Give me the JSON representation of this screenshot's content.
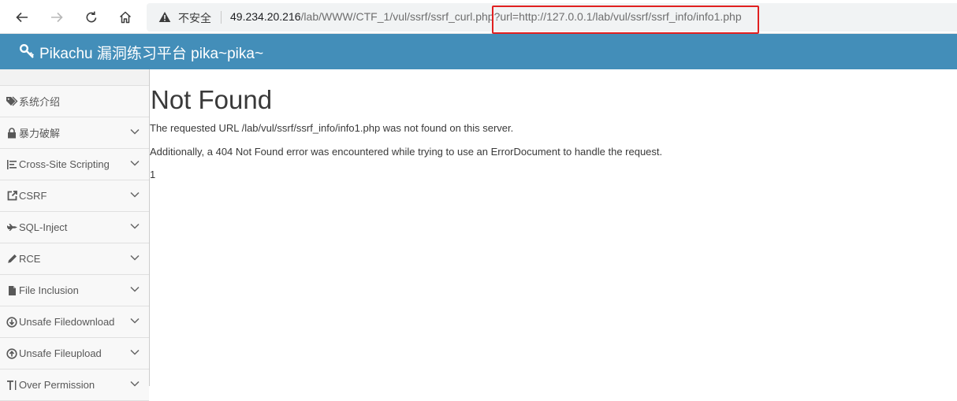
{
  "browser": {
    "not_secure_label": "不安全",
    "url_host": "49.234.20.216",
    "url_path": "/lab/WWW/CTF_1/vul/ssrf/ssrf_curl.php",
    "url_query": "?url=http://127.0.0.1/lab/vul/ssrf/ssrf_info/info1.php",
    "icons": [
      "back-arrow-icon",
      "forward-arrow-icon",
      "reload-icon",
      "home-icon",
      "warning-icon"
    ],
    "highlight_color": "#e02020"
  },
  "header": {
    "brand": "Pikachu 漏洞练习平台 pika~pika~",
    "icon": "key-icon",
    "background": "#438eb9"
  },
  "sidebar": {
    "items": [
      {
        "label": "系统介绍",
        "icon": "tags-icon",
        "has_submenu": false
      },
      {
        "label": "暴力破解",
        "icon": "lock-icon",
        "has_submenu": true
      },
      {
        "label": "Cross-Site Scripting",
        "icon": "list-tree-icon",
        "has_submenu": true
      },
      {
        "label": "CSRF",
        "icon": "share-square-icon",
        "has_submenu": true
      },
      {
        "label": "SQL-Inject",
        "icon": "fighter-jet-icon",
        "has_submenu": true
      },
      {
        "label": "RCE",
        "icon": "pencil-icon",
        "has_submenu": true
      },
      {
        "label": "File Inclusion",
        "icon": "file-icon",
        "has_submenu": true
      },
      {
        "label": "Unsafe Filedownload",
        "icon": "download-circle-icon",
        "has_submenu": true
      },
      {
        "label": "Unsafe Fileupload",
        "icon": "upload-circle-icon",
        "has_submenu": true
      },
      {
        "label": "Over Permission",
        "icon": "text-height-icon",
        "has_submenu": true
      }
    ]
  },
  "main": {
    "title": "Not Found",
    "message_1": "The requested URL /lab/vul/ssrf/ssrf_info/info1.php was not found on this server.",
    "message_2": "Additionally, a 404 Not Found error was encountered while trying to use an ErrorDocument to handle the request.",
    "message_3": "1"
  }
}
